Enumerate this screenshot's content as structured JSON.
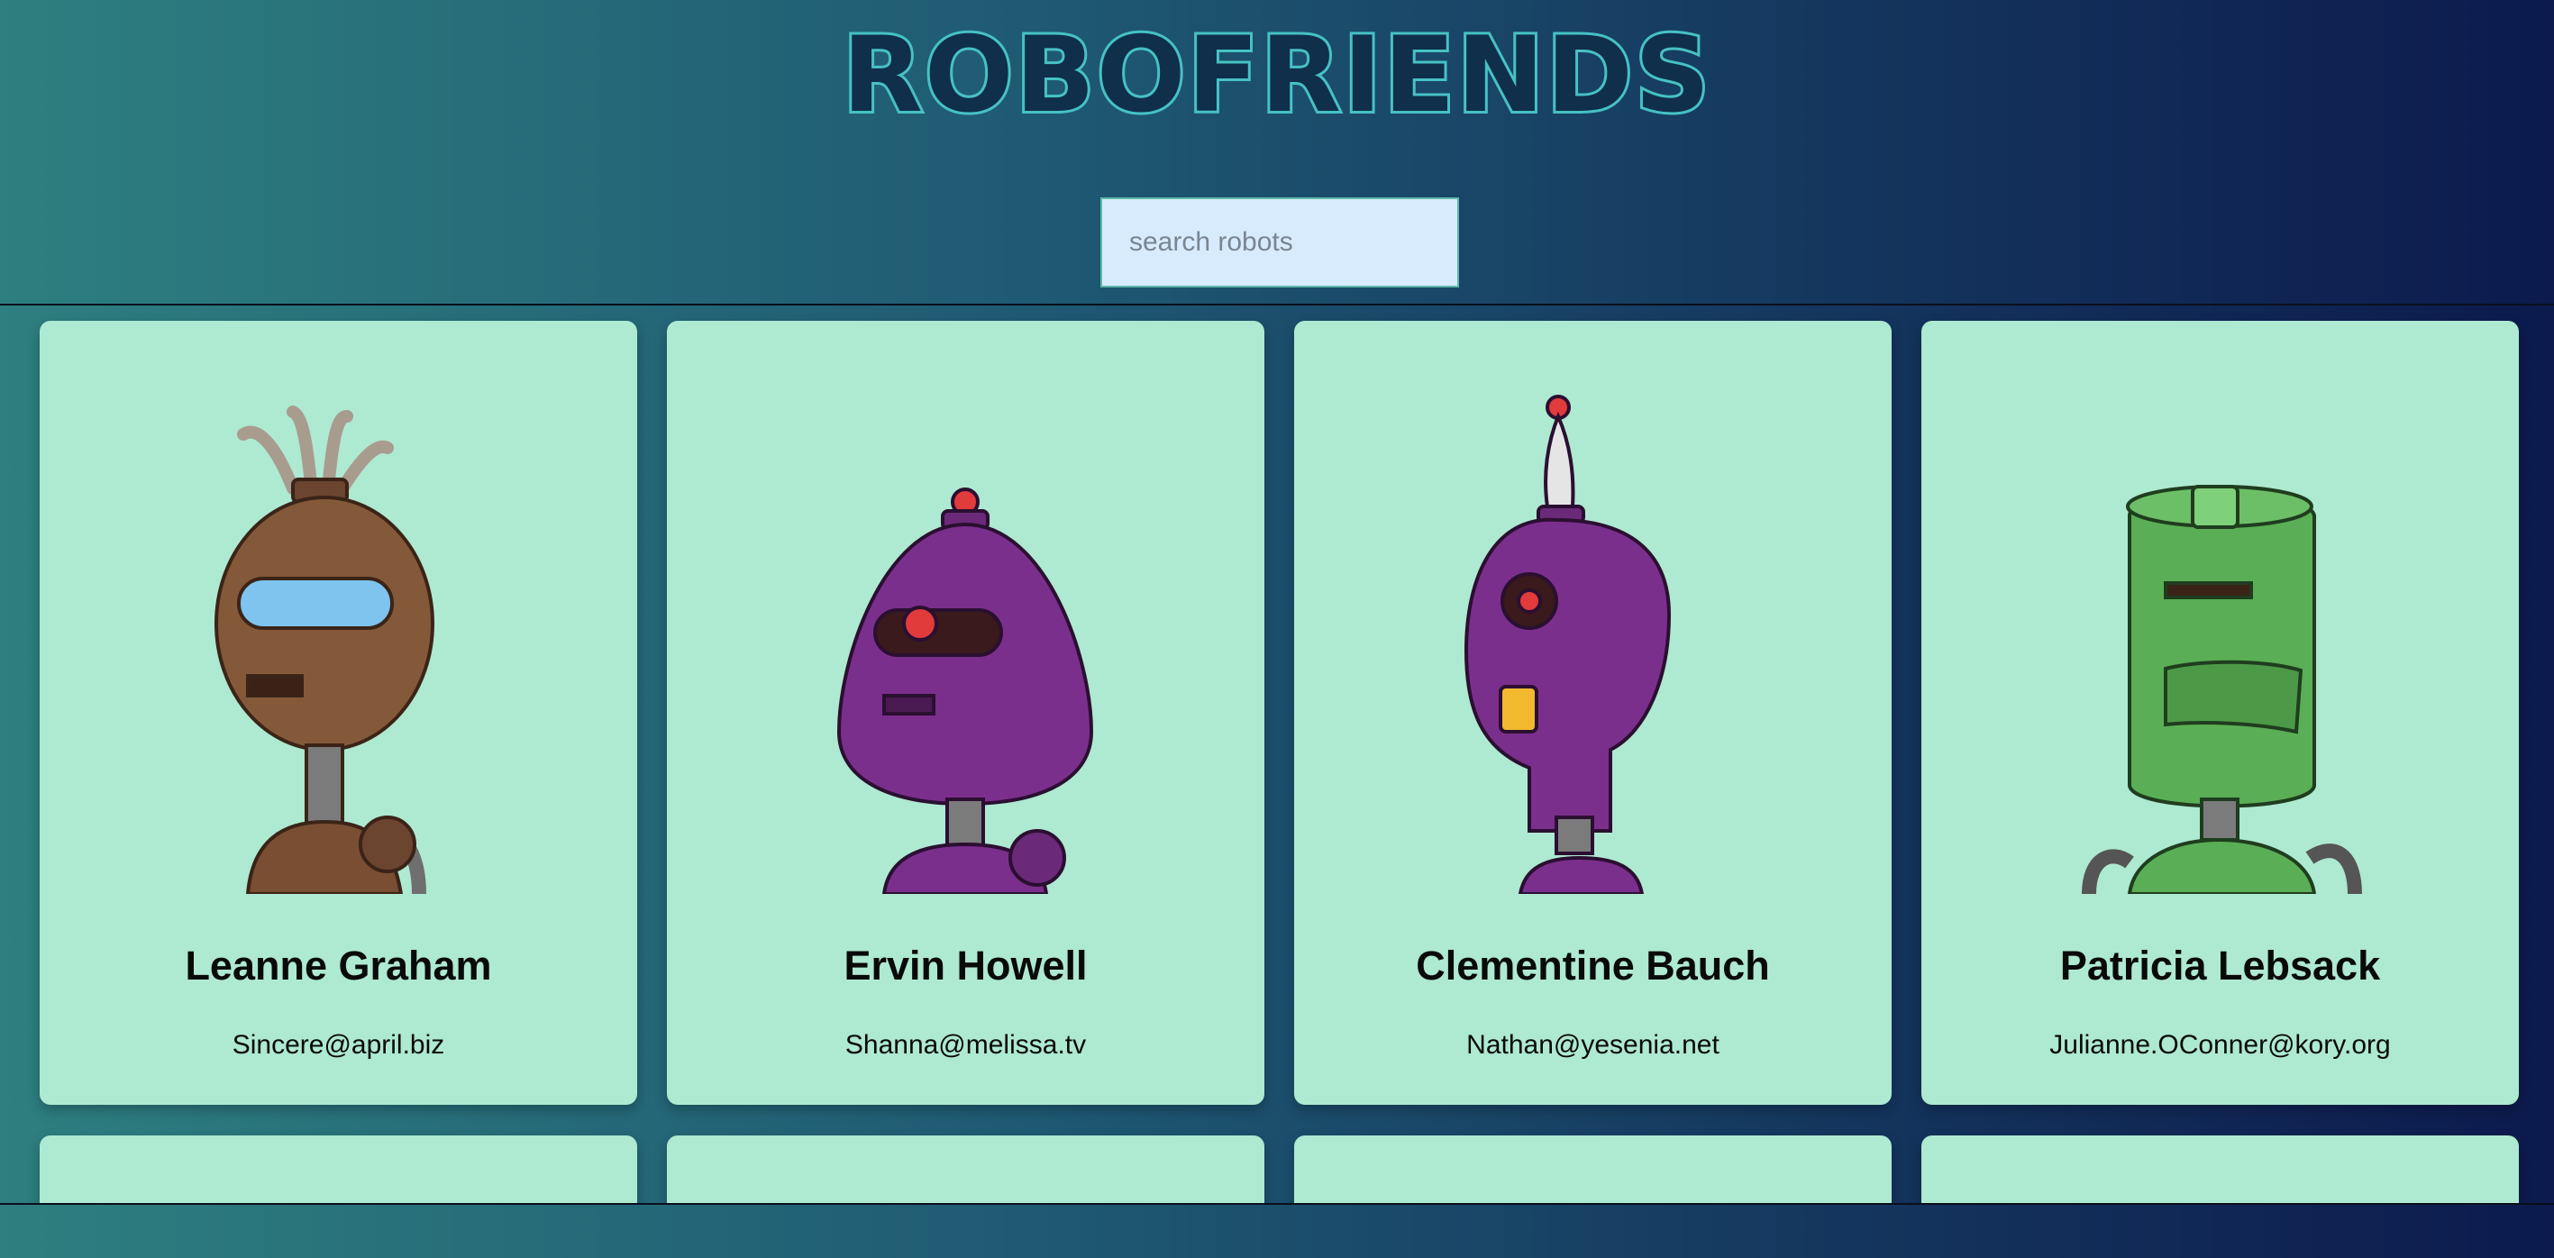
{
  "header": {
    "title": "ROBOFRIENDS",
    "search": {
      "placeholder": "search robots",
      "value": ""
    }
  },
  "robots": [
    {
      "name": "Leanne Graham",
      "email": "Sincere@april.biz",
      "avatar_icon": "brown-robot-avatar",
      "color": "#7a4e32"
    },
    {
      "name": "Ervin Howell",
      "email": "Shanna@melissa.tv",
      "avatar_icon": "purple-cyclops-robot-avatar",
      "color": "#7b2f8c"
    },
    {
      "name": "Clementine Bauch",
      "email": "Nathan@yesenia.net",
      "avatar_icon": "purple-antenna-robot-avatar",
      "color": "#7b2f8c"
    },
    {
      "name": "Patricia Lebsack",
      "email": "Julianne.OConner@kory.org",
      "avatar_icon": "green-can-robot-avatar",
      "color": "#5aae55"
    }
  ],
  "colors": {
    "card_bg": "#aee9d1",
    "title_stroke": "#46c1c4",
    "search_bg": "#d7ebfd"
  }
}
